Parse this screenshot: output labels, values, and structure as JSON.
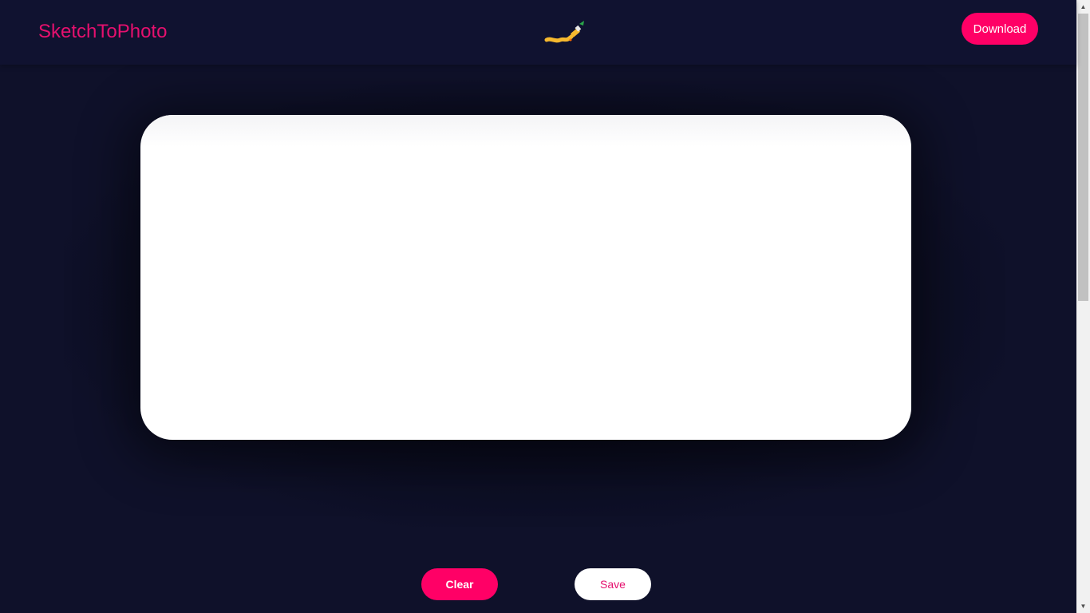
{
  "header": {
    "brand": "SketchToPhoto",
    "logo_icon": "paintbrush-icon",
    "download_label": "Download"
  },
  "canvas": {
    "name": "drawing-canvas"
  },
  "actions": {
    "clear_label": "Clear",
    "save_label": "Save"
  },
  "colors": {
    "background": "#0f112a",
    "navbar": "#101230",
    "accent": "#ff0066",
    "brand_text": "#e5106e",
    "canvas": "#ffffff",
    "brush_handle": "#f5b82e",
    "brush_bristles": "#2aa84a"
  }
}
